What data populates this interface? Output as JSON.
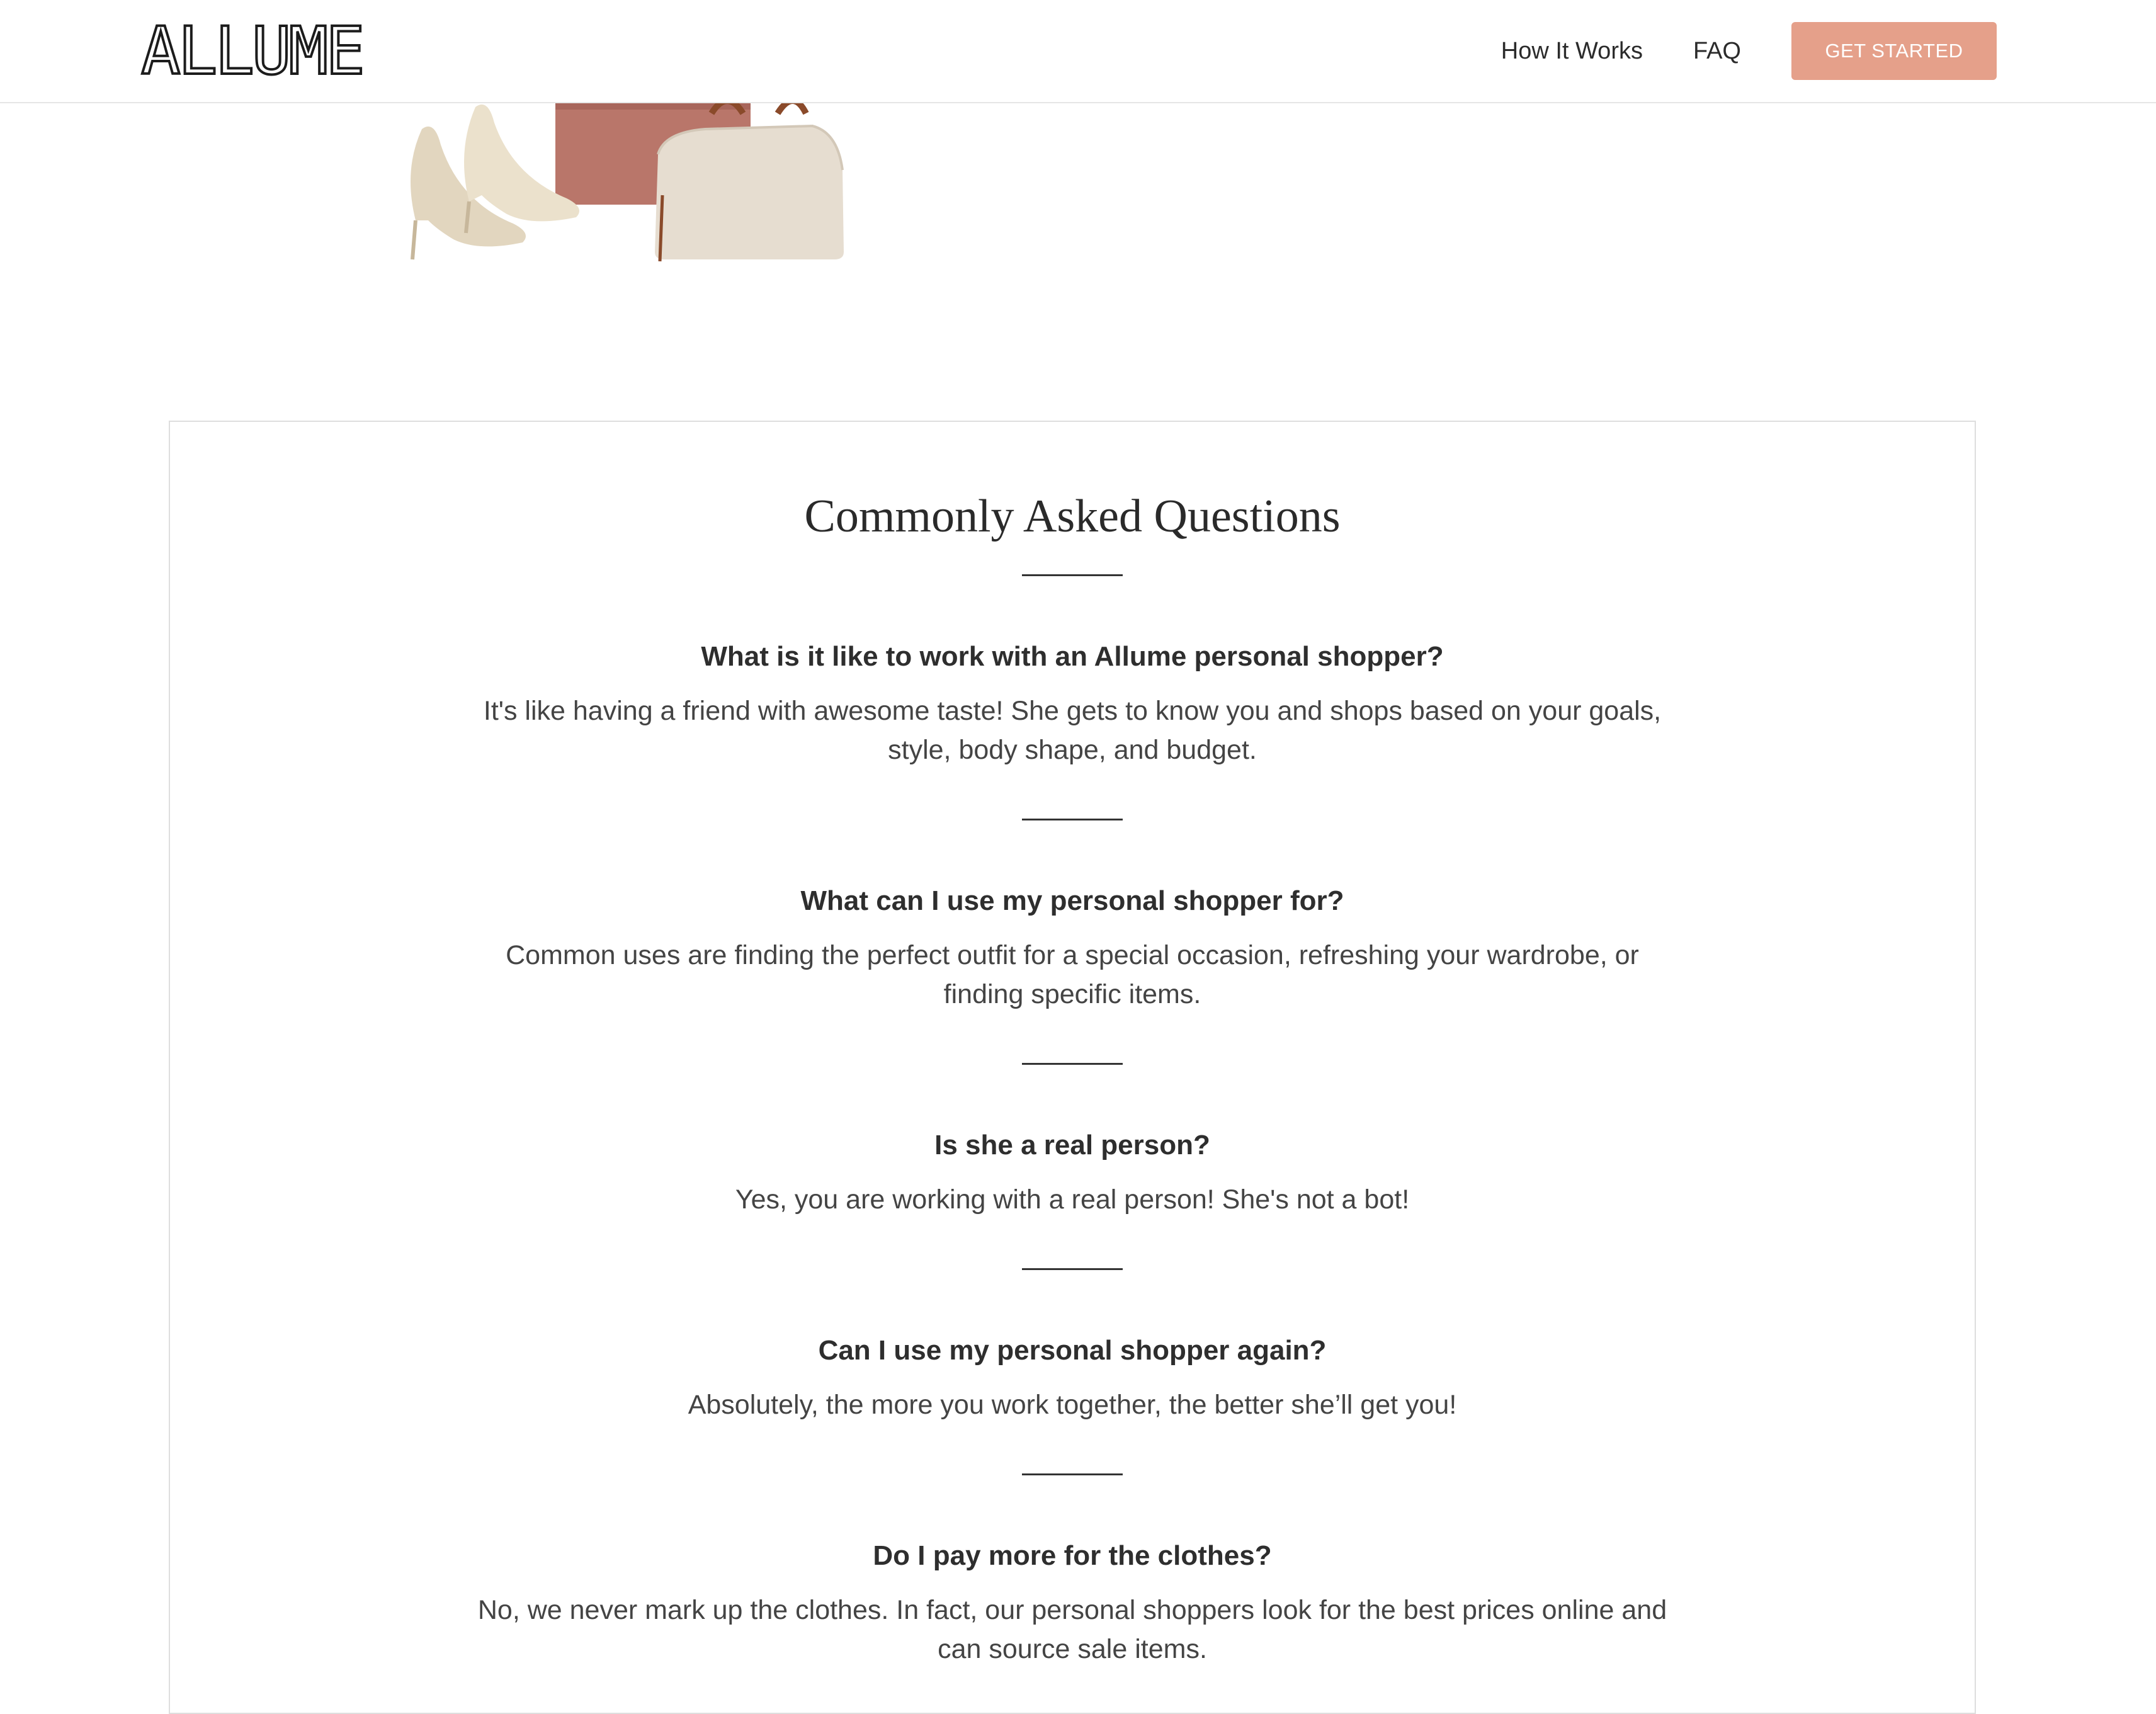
{
  "header": {
    "logo_text": "ALLUME",
    "nav": {
      "how_it_works": "How It Works",
      "faq": "FAQ",
      "get_started": "GET STARTED"
    },
    "accent_color": "#e5a08a"
  },
  "products_image": {
    "items": [
      "nude-pumps",
      "rose-tote-bag",
      "cream-tote-bag"
    ]
  },
  "faq": {
    "title": "Commonly Asked Questions",
    "items": [
      {
        "question": "What is it like to work with an Allume personal shopper?",
        "answer": "It's like having a friend with awesome taste! She gets to know you and shops based on your goals, style, body shape, and budget."
      },
      {
        "question": "What can I use my personal shopper for?",
        "answer": "Common uses are finding the perfect outfit for a special occasion, refreshing your wardrobe, or finding specific items."
      },
      {
        "question": "Is she a real person?",
        "answer": "Yes, you are working with a real person! She's not a bot!"
      },
      {
        "question": "Can I use my personal shopper again?",
        "answer": "Absolutely, the more you work together, the better she’ll get you!"
      },
      {
        "question": "Do I pay more for the clothes?",
        "answer": "No, we never mark up the clothes. In fact, our personal shoppers look for the best prices online and can source sale items."
      }
    ]
  }
}
